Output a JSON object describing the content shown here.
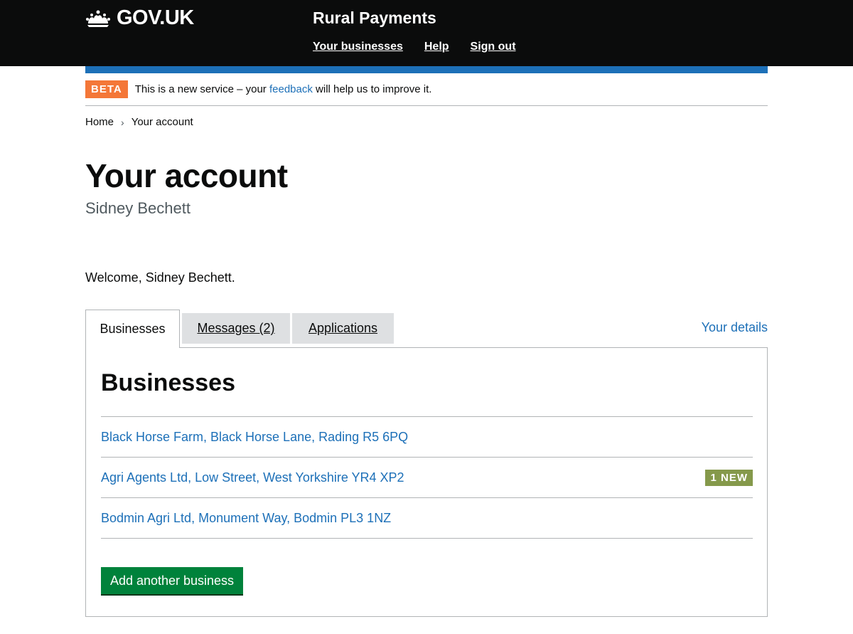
{
  "header": {
    "logo_text": "GOV.UK",
    "service_name": "Rural Payments",
    "nav": [
      "Your businesses",
      "Help",
      "Sign out"
    ]
  },
  "phase_banner": {
    "tag": "BETA",
    "text_before": "This is a new service – your ",
    "link": "feedback",
    "text_after": " will help us to improve it."
  },
  "breadcrumb": [
    "Home",
    "Your account"
  ],
  "page": {
    "title": "Your account",
    "caption": "Sidney Bechett",
    "welcome": "Welcome, Sidney Bechett."
  },
  "tabs": [
    "Businesses",
    "Messages (2)",
    "Applications"
  ],
  "details_link": "Your details",
  "panel": {
    "heading": "Businesses",
    "businesses": [
      {
        "name": "Black Horse Farm, Black Horse Lane, Rading R5 6PQ",
        "badge": ""
      },
      {
        "name": "Agri Agents Ltd, Low Street, West Yorkshire YR4 XP2",
        "badge": "1 NEW"
      },
      {
        "name": "Bodmin Agri Ltd, Monument Way, Bodmin PL3 1NZ",
        "badge": ""
      }
    ],
    "add_button": "Add another business"
  },
  "colors": {
    "header_bg": "#0b0c0c",
    "accent_blue": "#1d70b8",
    "beta_tag": "#f47738",
    "new_badge": "#85994b",
    "button_green": "#00823b"
  }
}
